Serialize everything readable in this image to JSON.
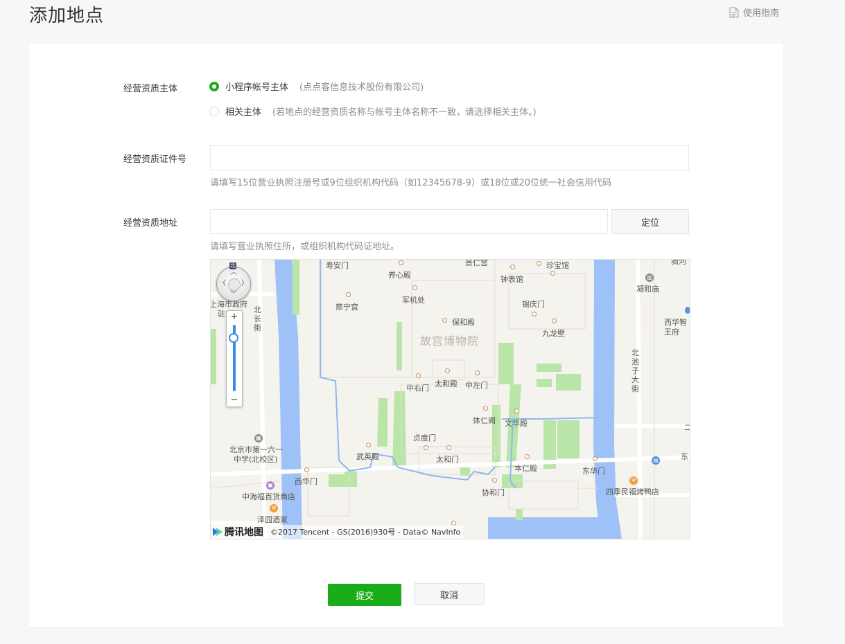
{
  "page": {
    "title": "添加地点",
    "guide_label": "使用指南"
  },
  "form": {
    "entity": {
      "label": "经营资质主体",
      "options": [
        {
          "label": "小程序帐号主体",
          "hint": "(点点客信息技术股份有限公司)",
          "checked": true
        },
        {
          "label": "相关主体",
          "hint": "(若地点的经营资质名称与帐号主体名称不一致，请选择相关主体。)",
          "checked": false
        }
      ]
    },
    "license": {
      "label": "经营资质证件号",
      "value": "",
      "hint": "请填写15位营业执照注册号或9位组织机构代码（如12345678-9）或18位或20位统一社会信用代码"
    },
    "address": {
      "label": "经营资质地址",
      "value": "",
      "locate_label": "定位",
      "hint": "请填写营业执照住所，或组织机构代码证地址。"
    }
  },
  "map": {
    "center_label": "故宫博物院",
    "labels": {
      "shouan": "寿安门",
      "yangxin": "养心殿",
      "jingren": "景仁宫",
      "zhenbao": "珍宝馆",
      "zhongbiao": "钟表馆",
      "cining": "慈宁宫",
      "junji": "军机处",
      "xiqing": "锡庆门",
      "baohe": "保和殿",
      "jiulong": "九龙壁",
      "zhongyou": "中右门",
      "taihedian": "太和殿",
      "zhongzuo": "中左门",
      "tiren": "体仁阁",
      "wenhua": "文华殿",
      "zhendu": "贞度门",
      "wuying": "武英殿",
      "taihemen": "太和门",
      "benren": "本仁殿",
      "donghua": "东华门",
      "xihua": "西华门",
      "xiehe": "协和门",
      "zhonghai": "中海福百货商店",
      "zeyuan": "泽园酒家",
      "sijimin": "四季民福烤鸭店",
      "school_1": "北京市第一六一",
      "school_2": "中学(北校区)",
      "shanghai_1": "上海市政府",
      "shanghai_2": "驻京",
      "beichang": "北长街",
      "beichizi": "北池子大街",
      "ninghe": "凝和庙",
      "xihuazhi": "西华智",
      "wangfu": "王府",
      "dong": "东",
      "ertop": "二",
      "huashan": "骑河"
    },
    "logo_text": "腾讯地图",
    "copyright": "©2017 Tencent - GS(2016)930号 - Data© NavInfo",
    "north_label": "北",
    "zoom_in": "+",
    "zoom_out": "−",
    "zoom_level": 0.85,
    "colors": {
      "water": "#9ec1f7",
      "green": "#b9e6a8",
      "road": "#ffffff",
      "land": "#f5f3ee"
    }
  },
  "actions": {
    "submit_label": "提交",
    "cancel_label": "取消"
  },
  "colors": {
    "primary": "#1aad19",
    "hint": "#8d8d8d",
    "background": "#f6f7f9"
  }
}
